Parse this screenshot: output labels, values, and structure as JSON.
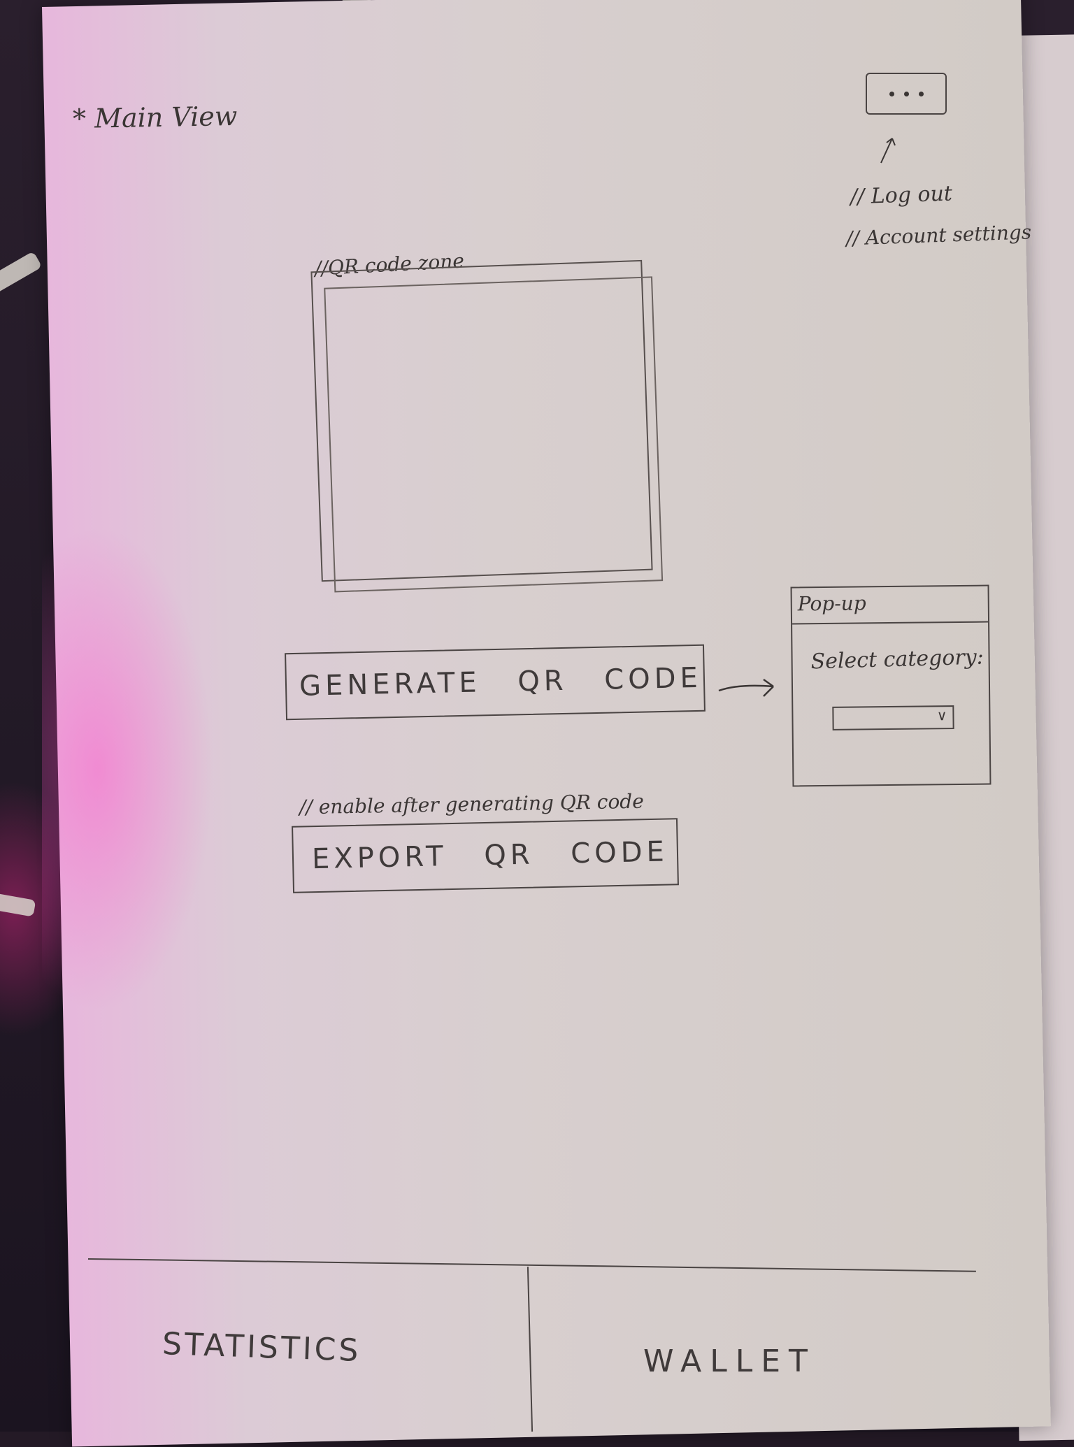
{
  "header": {
    "screen_title": "* Main View",
    "more_menu_annotations": [
      "// Log out",
      "// Account settings"
    ]
  },
  "qr_zone": {
    "label": "//QR code zone"
  },
  "generate_button": {
    "label": "GENERATE QR CODE"
  },
  "popup": {
    "title": "Pop-up",
    "select_label": "Select category:",
    "select_value": ""
  },
  "export_button": {
    "note": "// enable after generating QR code",
    "label": "EXPORT QR CODE"
  },
  "bottom_nav": {
    "tabs": [
      {
        "label": "STATISTICS"
      },
      {
        "label": "WALLET"
      }
    ]
  },
  "colors": {
    "ink": "#3a3534",
    "paper": "#d8cfcf",
    "pink_glow": "#ff50c8"
  },
  "icons": {
    "more": "more-dots-icon",
    "select_chevron": "chevron-down-icon",
    "arrow": "arrow-right-icon"
  }
}
